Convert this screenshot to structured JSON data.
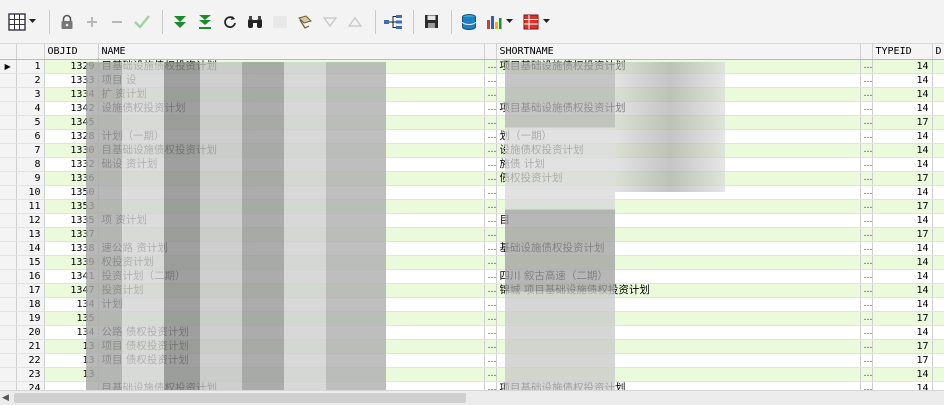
{
  "grid": {
    "columns": [
      "OBJID",
      "NAME",
      "SHORTNAME",
      "TYPEID",
      "D"
    ],
    "rows": [
      {
        "num": "1",
        "objid": "1329",
        "name": "目基础设施债权投资计划",
        "short": "项目基础设施债权投资计划",
        "typeid": "14"
      },
      {
        "num": "2",
        "objid": "1333",
        "name": "项目 设",
        "short": "",
        "typeid": "14"
      },
      {
        "num": "3",
        "objid": "1334",
        "name": "扩 资计划",
        "short": "",
        "typeid": "14"
      },
      {
        "num": "4",
        "objid": "1342",
        "name": "设施债权投资计划",
        "short": "项目基础设施债权投资计划",
        "typeid": "14"
      },
      {
        "num": "5",
        "objid": "1345",
        "name": "",
        "short": "",
        "typeid": "17"
      },
      {
        "num": "6",
        "objid": "1328",
        "name": "计划（一期）",
        "short": "划（一期）",
        "typeid": "14"
      },
      {
        "num": "7",
        "objid": "1330",
        "name": "目基础设施债权投资计划",
        "short": "设施债权投资计划",
        "typeid": "14"
      },
      {
        "num": "8",
        "objid": "1332",
        "name": "础设 资计划",
        "short": "施债 计划",
        "typeid": "14"
      },
      {
        "num": "9",
        "objid": "1336",
        "name": "",
        "short": "债权投资计划",
        "typeid": "17"
      },
      {
        "num": "10",
        "objid": "1350",
        "name": "",
        "short": "",
        "typeid": "14"
      },
      {
        "num": "11",
        "objid": "1353",
        "name": "",
        "short": "",
        "typeid": "17"
      },
      {
        "num": "12",
        "objid": "1335",
        "name": "项 资计划",
        "short": "目",
        "typeid": "14"
      },
      {
        "num": "13",
        "objid": "1337",
        "name": "",
        "short": "",
        "typeid": "17"
      },
      {
        "num": "14",
        "objid": "1338",
        "name": "速公路 资计划",
        "short": "基础设施债权投资计划",
        "typeid": "14"
      },
      {
        "num": "15",
        "objid": "1339",
        "name": "权投资计划",
        "short": "",
        "typeid": "14"
      },
      {
        "num": "16",
        "objid": "1341",
        "name": "投资计划（二期）",
        "short": "四川 叙古高速（二期）",
        "typeid": "14"
      },
      {
        "num": "17",
        "objid": "1347",
        "name": "投资计划",
        "short": "锦城 项目基础设施债权投资计划",
        "typeid": "14"
      },
      {
        "num": "18",
        "objid": "134",
        "name": "计划",
        "short": "",
        "typeid": "14"
      },
      {
        "num": "19",
        "objid": "135",
        "name": "",
        "short": "",
        "typeid": "17"
      },
      {
        "num": "20",
        "objid": "134",
        "name": "公路 债权投资计划",
        "short": "",
        "typeid": "14"
      },
      {
        "num": "21",
        "objid": "13",
        "name": "项目 债权投资计划",
        "short": "",
        "typeid": "17"
      },
      {
        "num": "22",
        "objid": "13",
        "name": "项目 债权投资计划",
        "short": "",
        "typeid": "17"
      },
      {
        "num": "23",
        "objid": "13",
        "name": "",
        "short": "",
        "typeid": "14"
      },
      {
        "num": "24",
        "objid": "",
        "name": "目基础设施债权投资计划",
        "short": "项目基础设施债权投资计划",
        "typeid": "14"
      }
    ]
  }
}
